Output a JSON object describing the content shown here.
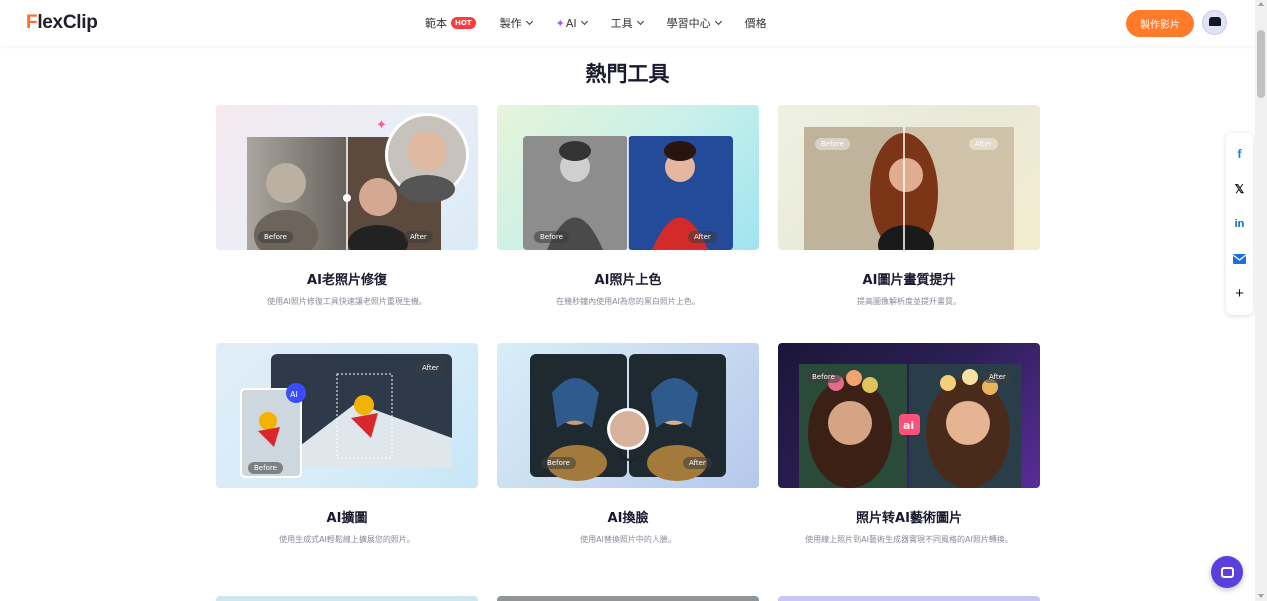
{
  "header": {
    "logo": "FlexClip",
    "nav": [
      {
        "label": "範本",
        "badge": "HOT"
      },
      {
        "label": "製作"
      },
      {
        "label": "AI"
      },
      {
        "label": "工具"
      },
      {
        "label": "學習中心"
      },
      {
        "label": "價格"
      }
    ],
    "cta": "製作影片"
  },
  "section": {
    "title": "熱門工具"
  },
  "cards": [
    {
      "title": "AI老照片修復",
      "desc": "使用AI照片修復工具快速讓老照片重現生機。",
      "before": "Before",
      "after": "After"
    },
    {
      "title": "AI照片上色",
      "desc": "在幾秒鐘內使用AI為您的黑白照片上色。",
      "before": "Before",
      "after": "After"
    },
    {
      "title": "AI圖片畫質提升",
      "desc": "提高圖像解析度並提升畫質。",
      "before": "Before",
      "after": "After"
    },
    {
      "title": "AI擴圖",
      "desc": "使用生成式AI輕鬆線上擴展您的照片。",
      "before": "Before",
      "after": "After"
    },
    {
      "title": "AI換臉",
      "desc": "使用AI替換照片中的人臉。",
      "before": "Before",
      "after": "After"
    },
    {
      "title": "照片转AI藝術圖片",
      "desc": "使用線上照片到AI藝術生成器實現不同風格的AI照片轉換。",
      "before": "Before",
      "after": "After"
    }
  ],
  "share": [
    "facebook-icon",
    "x-icon",
    "linkedin-icon",
    "mail-icon",
    "plus-icon"
  ],
  "colors": {
    "accent": "#ff7a29",
    "chat": "#5b3fdc"
  }
}
